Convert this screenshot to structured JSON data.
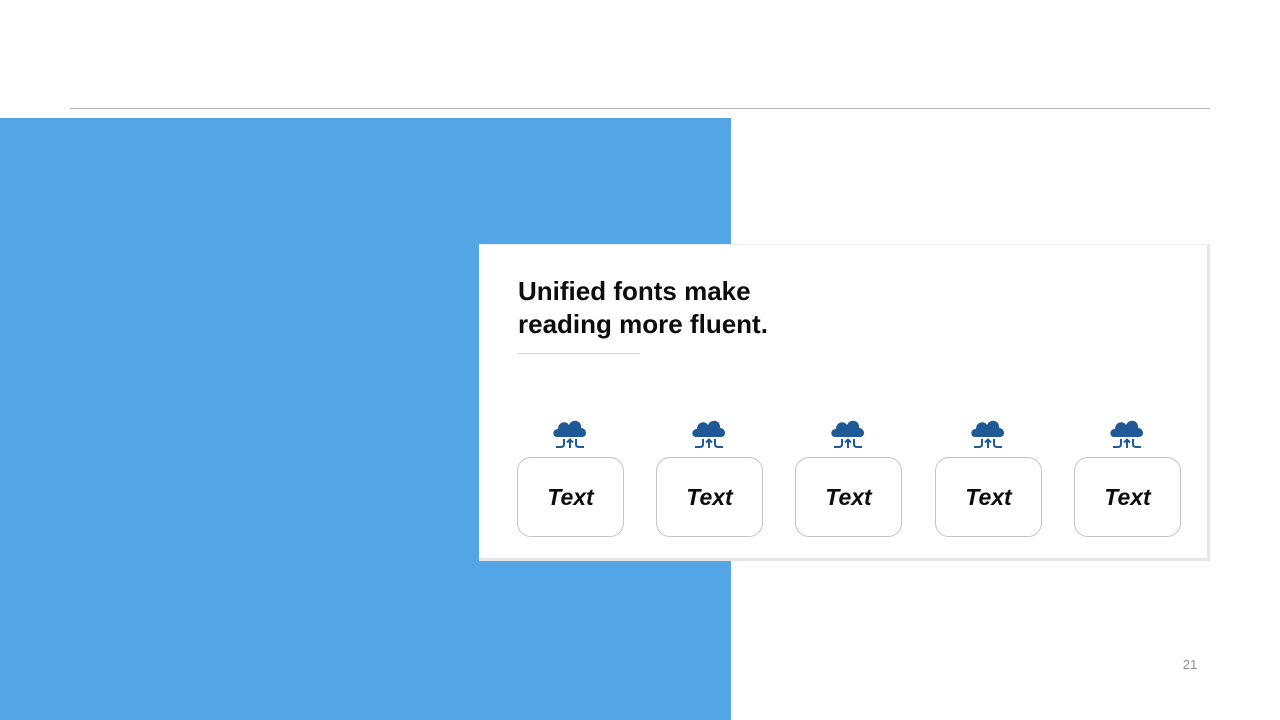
{
  "slide": {
    "title": "Unified fonts make\nreading more fluent.",
    "page_number": "21",
    "accent_color": "#53a5e6",
    "icon_color": "#1f5a96"
  },
  "items": [
    {
      "label": "Text",
      "icon": "cloud-transfer-icon"
    },
    {
      "label": "Text",
      "icon": "cloud-transfer-icon"
    },
    {
      "label": "Text",
      "icon": "cloud-transfer-icon"
    },
    {
      "label": "Text",
      "icon": "cloud-transfer-icon"
    },
    {
      "label": "Text",
      "icon": "cloud-transfer-icon"
    }
  ]
}
